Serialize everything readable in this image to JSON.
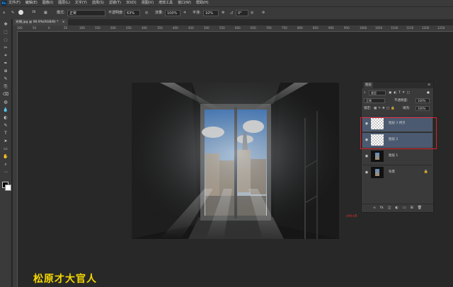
{
  "app": {
    "logo": "Ps"
  },
  "menu": [
    "文件(F)",
    "编辑(E)",
    "图像(I)",
    "图层(L)",
    "文字(Y)",
    "选择(S)",
    "滤镜(T)",
    "3D(D)",
    "视图(V)",
    "增效工具",
    "窗口(W)",
    "帮助(H)"
  ],
  "options": {
    "brush_size": "38",
    "mode_label": "模式:",
    "mode_value": "正常",
    "opacity_label": "不透明度:",
    "opacity_value": "63%",
    "flow_label": "流量:",
    "flow_value": "100%",
    "smooth_label": "平滑:",
    "smooth_value": "10%",
    "angle_value": "0°"
  },
  "document": {
    "tab_title": "光线.jpg @ 90.9%(RGB/8) *"
  },
  "ruler": {
    "ticks": [
      "100",
      "50",
      "0",
      "50",
      "100",
      "150",
      "200",
      "250",
      "300",
      "350",
      "400",
      "450",
      "500",
      "550",
      "600",
      "650",
      "700",
      "750",
      "800",
      "850",
      "900",
      "950",
      "1000",
      "1050",
      "1100",
      "1150",
      "1200",
      "1250"
    ]
  },
  "layers_panel": {
    "title": "图层",
    "filter_kind": "类型",
    "blend_mode": "正常",
    "opacity_label": "不透明度:",
    "opacity_value": "100%",
    "lock_label": "锁定:",
    "fill_label": "填充:",
    "fill_value": "100%",
    "layers": [
      {
        "name": "图层 3 拷贝",
        "thumb": "transparent",
        "selected": true
      },
      {
        "name": "图层 2",
        "thumb": "transparent",
        "selected": true
      },
      {
        "name": "图层 1",
        "thumb": "photo",
        "selected": false
      },
      {
        "name": "背景",
        "thumb": "photo",
        "selected": false,
        "locked": true
      }
    ]
  },
  "hint_text": "ctrl+E",
  "watermark": "松原才大官人",
  "colors": {
    "selected_layer": "#4b5a70",
    "highlight_box": "#e0202a",
    "watermark": "#f5d800",
    "hint": "#e03030"
  }
}
